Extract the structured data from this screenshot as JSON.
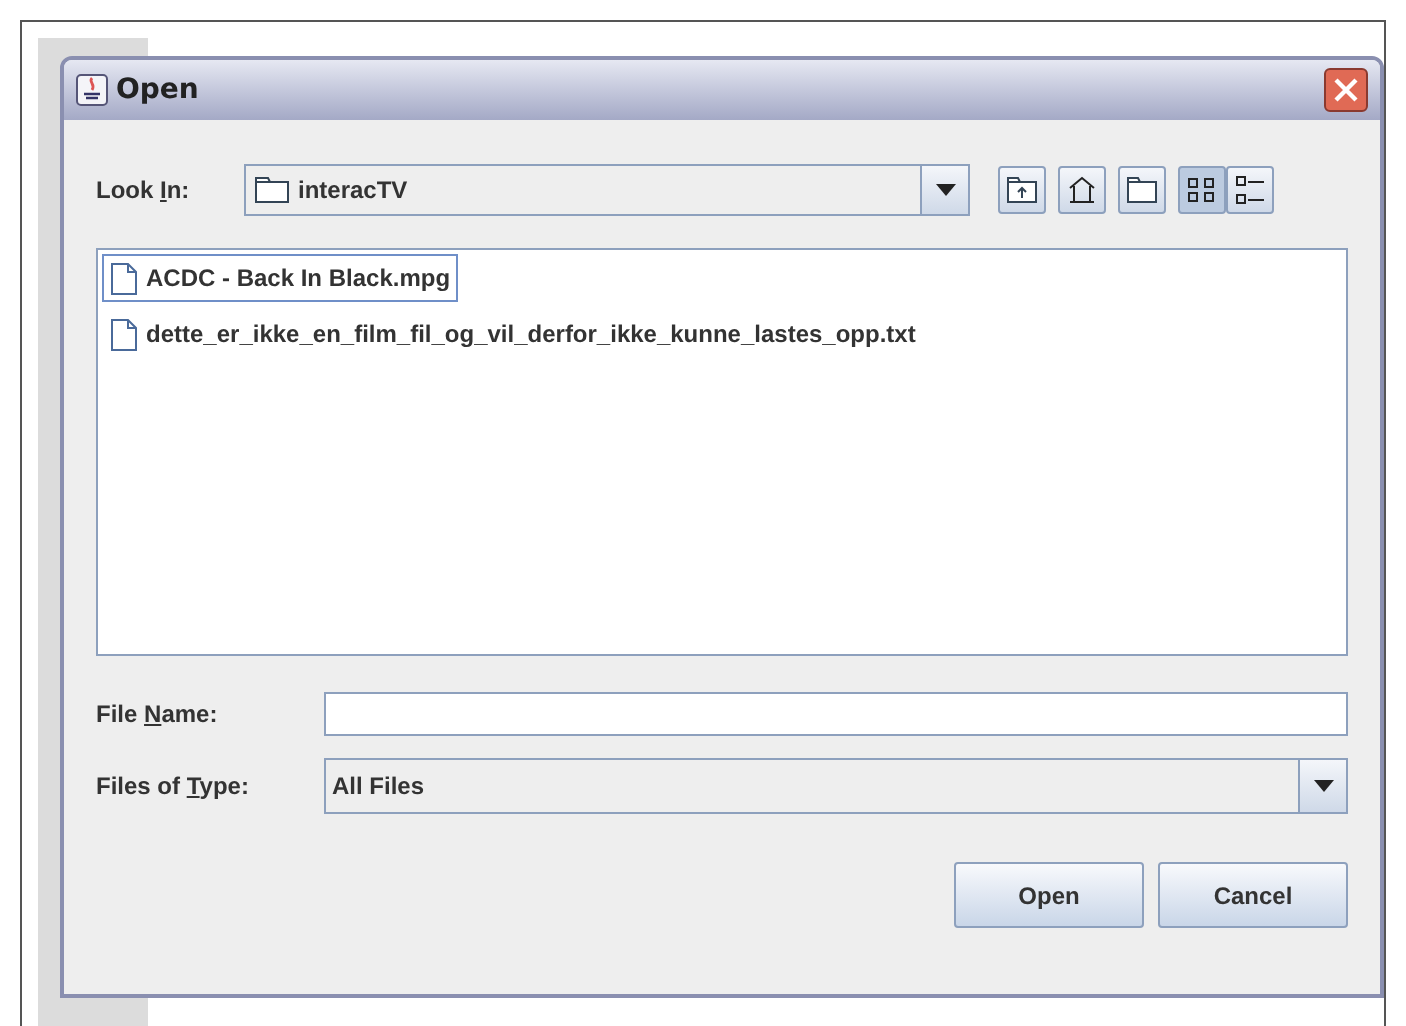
{
  "dialog": {
    "title": "Open"
  },
  "look_in": {
    "label": {
      "before": "Look ",
      "mnemonic": "I",
      "after": "n:"
    },
    "value": "interacTV"
  },
  "view_buttons": [
    {
      "kind": "list",
      "selected": true
    },
    {
      "kind": "details",
      "selected": false
    }
  ],
  "files": [
    {
      "name": "ACDC - Back In Black.mpg",
      "selected": true
    },
    {
      "name": "dette_er_ikke_en_film_fil_og_vil_derfor_ikke_kunne_lastes_opp.txt",
      "selected": false
    }
  ],
  "file_name": {
    "label": {
      "before": "File ",
      "mnemonic": "N",
      "after": "ame:"
    }
  },
  "file_type": {
    "label": {
      "before": "Files of ",
      "mnemonic": "T",
      "after": "ype:"
    },
    "value": "All Files"
  },
  "buttons": [
    "Open",
    "Cancel"
  ]
}
